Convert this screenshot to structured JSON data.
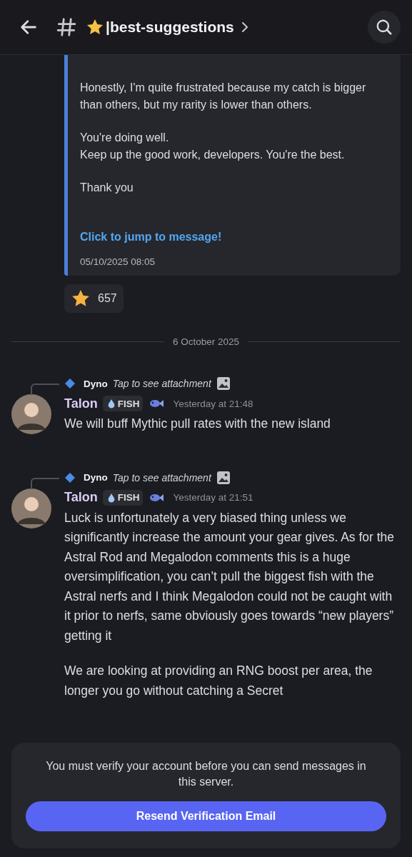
{
  "header": {
    "channel_name": "|best-suggestions"
  },
  "embed": {
    "paragraphs": [
      "Honestly, I'm quite frustrated because my catch is bigger than others, but my rarity is lower than others.",
      "You're doing well.\nKeep up the good work, developers. You're the best.",
      "Thank you"
    ],
    "link": "Click to jump to message!",
    "timestamp": "05/10/2025 08:05"
  },
  "reactions": [
    {
      "count": "657"
    }
  ],
  "date_divider": "6 October 2025",
  "messages": [
    {
      "reply": {
        "author": "Dyno",
        "text": "Tap to see attachment"
      },
      "author": "Talon",
      "tag": "FISH",
      "time": "Yesterday at 21:48",
      "paragraphs": [
        "We will buff Mythic pull rates with the new island"
      ]
    },
    {
      "reply": {
        "author": "Dyno",
        "text": "Tap to see attachment"
      },
      "author": "Talon",
      "tag": "FISH",
      "time": "Yesterday at 21:51",
      "paragraphs": [
        "Luck is unfortunately a very biased thing unless we significantly increase the amount your gear gives. As for the Astral Rod and Megalodon comments this is a huge oversimplification, you can’t pull the biggest fish with the Astral nerfs and I think Megalodon could not be caught with it prior to nerfs, same obviously goes towards “new players” getting it",
        "We are looking at providing an RNG boost per area, the longer you go without catching a Secret"
      ]
    }
  ],
  "verify_bar": {
    "notice": "You must verify your account before you can send messages in this server.",
    "button": "Resend Verification Email"
  }
}
